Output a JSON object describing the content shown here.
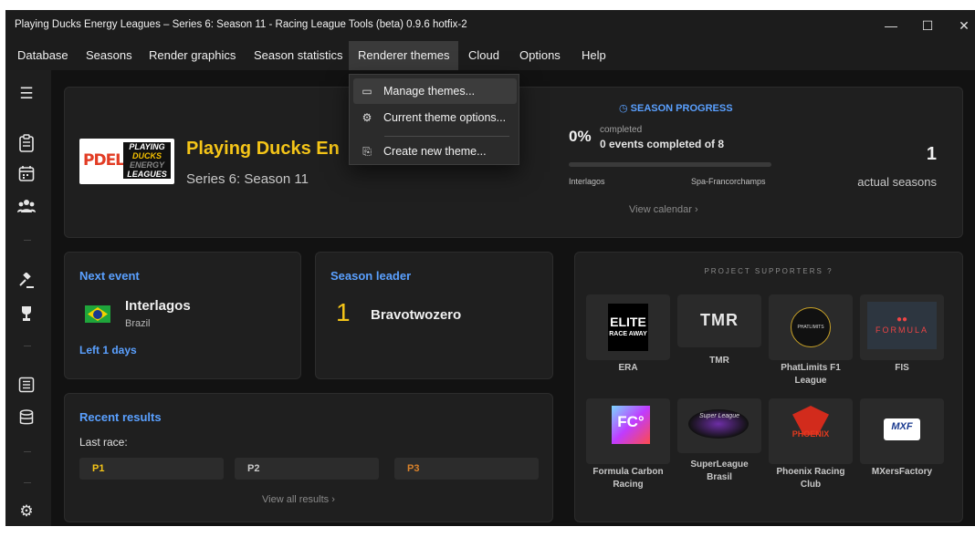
{
  "window": {
    "title": "Playing Ducks Energy Leagues – Series 6: Season 11 - Racing League Tools (beta) 0.9.6 hotfix-2",
    "minimize": "—",
    "maximize": "☐",
    "close": "✕"
  },
  "menu": [
    "Database",
    "Seasons",
    "Render graphics",
    "Season statistics",
    "Renderer themes",
    "Cloud",
    "Options",
    "Help"
  ],
  "active_menu": "Renderer themes",
  "dropdown": {
    "items": [
      {
        "label": "Manage themes...",
        "icon": "monitor-icon"
      },
      {
        "label": "Current theme options...",
        "icon": "gear-icon"
      },
      {
        "label": "Create new theme...",
        "icon": "new-file-icon"
      }
    ]
  },
  "sidebar_icons": [
    "hamburger-icon",
    "clipboard-icon",
    "calendar-icon",
    "drivers-icon",
    "gavel-icon",
    "trophy-icon",
    "standings-icon",
    "database-icon",
    "settings-icon"
  ],
  "league": {
    "logo_text": {
      "pdel": "PDEL",
      "line1": "PLAYING",
      "line2": "DUCKS",
      "line3": "ENERGY",
      "line4": "LEAGUES"
    },
    "name": "Playing Ducks Energy Leagues",
    "name_visible": "Playing Ducks En",
    "season": "Series 6: Season 11"
  },
  "season_progress": {
    "heading": "SEASON PROGRESS",
    "percent": "0%",
    "completed_label": "completed",
    "events_text": "0 events completed of 8",
    "progress": 0.0,
    "first_track": "Interlagos",
    "last_track": "Spa-Francorchamps",
    "calendar_link": "View calendar  ›",
    "actual_seasons_count": "1",
    "actual_seasons_label": "actual seasons"
  },
  "next_event": {
    "heading": "Next event",
    "name": "Interlagos",
    "country": "Brazil",
    "left_days": "Left 1 days"
  },
  "season_leader": {
    "heading": "Season leader",
    "position": "1",
    "name": "Bravotwozero"
  },
  "recent_results": {
    "heading": "Recent results",
    "last_race_label": "Last race:",
    "positions": [
      {
        "label": "P1",
        "color": "#f5c518"
      },
      {
        "label": "P2",
        "color": "#c9c9c9"
      },
      {
        "label": "P3",
        "color": "#d9822b"
      }
    ],
    "view_all": "View all results  ›"
  },
  "supporters": {
    "heading": "PROJECT SUPPORTERS  ?",
    "items": [
      {
        "name": "ERA",
        "logo_text": "ELITE",
        "logo_sub": "RACE AWAY"
      },
      {
        "name": "TMR",
        "logo_text": "TMR"
      },
      {
        "name": "PhatLimits F1 League",
        "logo_text": "PHATLIMITS"
      },
      {
        "name": "FIS",
        "logo_text": "FORMULA"
      },
      {
        "name": "Formula Carbon Racing",
        "logo_text": "FC°"
      },
      {
        "name": "SuperLeague Brasil",
        "logo_text": "Super League"
      },
      {
        "name": "Phoenix Racing Club",
        "logo_text": "PHOENIX"
      },
      {
        "name": "MXersFactory",
        "logo_text": "MXF"
      }
    ]
  }
}
